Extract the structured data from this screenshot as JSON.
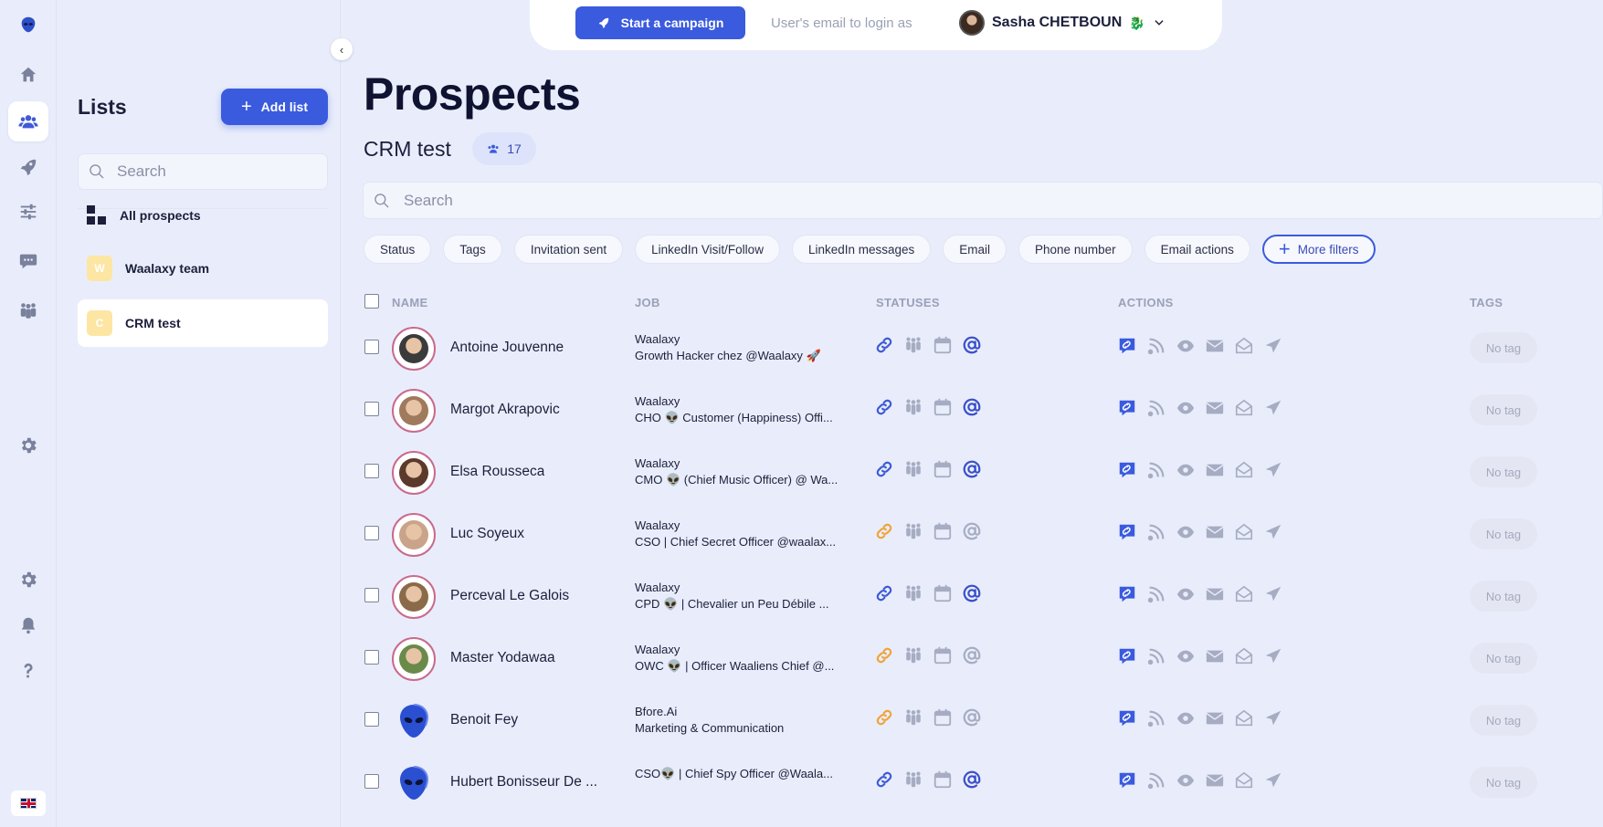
{
  "colors": {
    "accent": "#3a5bde",
    "bg": "#e9edfb",
    "link_active": "#3f5bd6",
    "link_pending": "#f0a43a",
    "icon_muted": "#a6acc2"
  },
  "rail": {
    "items": [
      {
        "icon": "logo-icon"
      },
      {
        "icon": "home-icon"
      },
      {
        "icon": "users-icon",
        "active": true
      },
      {
        "icon": "rocket-icon"
      },
      {
        "icon": "sliders-icon"
      },
      {
        "icon": "chat-icon"
      },
      {
        "icon": "team-icon"
      },
      {
        "icon": "gear-icon"
      },
      {
        "icon": "settings-icon"
      },
      {
        "icon": "bell-icon"
      },
      {
        "icon": "help-icon"
      }
    ],
    "language": "en-flag-icon"
  },
  "lists": {
    "title": "Lists",
    "add_label": "Add list",
    "search_placeholder": "Search",
    "items": [
      {
        "label": "All prospects",
        "icon": "grid-icon"
      },
      {
        "label": "Waalaxy team",
        "badge": "W"
      },
      {
        "label": "CRM test",
        "badge": "C",
        "active": true
      }
    ]
  },
  "topbar": {
    "start_campaign": "Start a campaign",
    "email_login": "User's email to login as",
    "user_name": "Sasha CHETBOUN",
    "user_emoji": "🐉"
  },
  "page": {
    "title": "Prospects",
    "list_name": "CRM test",
    "count": "17",
    "search_placeholder": "Search"
  },
  "filters": [
    "Status",
    "Tags",
    "Invitation sent",
    "LinkedIn Visit/Follow",
    "LinkedIn messages",
    "Email",
    "Phone number",
    "Email actions"
  ],
  "more_filters": "More filters",
  "table": {
    "headers": {
      "name": "NAME",
      "job": "JOB",
      "statuses": "STATUSES",
      "actions": "ACTIONS",
      "tags": "TAGS"
    },
    "rows": [
      {
        "name": "Antoine Jouvenne",
        "company": "Waalaxy",
        "title": "Growth Hacker chez @Waalaxy 🚀",
        "link": "active",
        "email": "active",
        "tag": "No tag",
        "avatar_color": "#3b3b3b",
        "alien": false
      },
      {
        "name": "Margot Akrapovic",
        "company": "Waalaxy",
        "title": "CHO 👽 Customer (Happiness) Offi...",
        "link": "active",
        "email": "active",
        "tag": "No tag",
        "avatar_color": "#a07a5c",
        "alien": false
      },
      {
        "name": "Elsa Rousseca",
        "company": "Waalaxy",
        "title": "CMO 👽 (Chief Music Officer) @ Wa...",
        "link": "active",
        "email": "active",
        "tag": "No tag",
        "avatar_color": "#5b3a2c",
        "alien": false
      },
      {
        "name": "Luc Soyeux",
        "company": "Waalaxy",
        "title": "CSO | Chief Secret Officer @waalax...",
        "link": "pending",
        "email": "muted",
        "tag": "No tag",
        "avatar_color": "#c9a48a",
        "alien": false
      },
      {
        "name": "Perceval Le Galois",
        "company": "Waalaxy",
        "title": "CPD 👽 | Chevalier un Peu Débile ...",
        "link": "active",
        "email": "active",
        "tag": "No tag",
        "avatar_color": "#8a6a48",
        "alien": false
      },
      {
        "name": "Master Yodawaa",
        "company": "Waalaxy",
        "title": "OWC 👽 | Officer Waaliens Chief @...",
        "link": "pending",
        "email": "muted",
        "tag": "No tag",
        "avatar_color": "#6a8a4a",
        "alien": false
      },
      {
        "name": "Benoit Fey",
        "company": "Bfore.Ai",
        "title": "Marketing & Communication",
        "link": "pending",
        "email": "muted",
        "tag": "No tag",
        "avatar_color": "#2b4fd1",
        "alien": true
      },
      {
        "name": "Hubert Bonisseur De ...",
        "company": "",
        "title": "CSO👽 | Chief Spy Officer @Waala...",
        "link": "active",
        "email": "active",
        "tag": "No tag",
        "avatar_color": "#2b4fd1",
        "alien": true
      }
    ]
  }
}
